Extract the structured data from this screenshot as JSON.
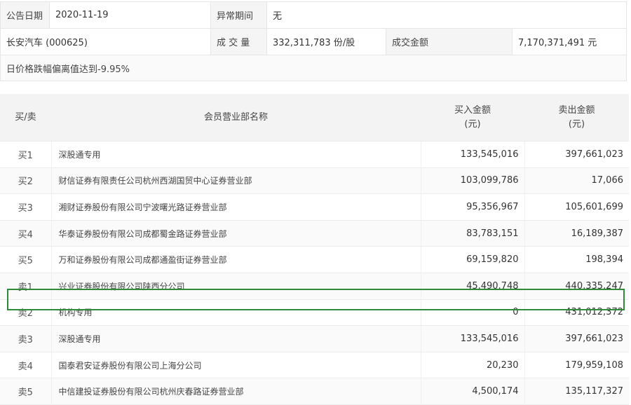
{
  "info": {
    "date_label": "公告日期",
    "date_value": "2020-11-19",
    "period_label": "异常期间",
    "period_value": "无",
    "stock_name": "长安汽车 (000625)",
    "volume_label": "成 交 量",
    "volume_value": "332,311,783 份/股",
    "amount_label": "成交金额",
    "amount_value": "7,170,371,491 元",
    "reason": "日价格跌幅偏离值达到-9.95%"
  },
  "table": {
    "headers": {
      "type": "买/卖",
      "name": "会员营业部名称",
      "buy": "买入金额\n(元)",
      "sell": "卖出金额\n(元)"
    },
    "rows": [
      {
        "type": "买1",
        "name": "深股通专用",
        "buy": "133,545,016",
        "sell": "397,661,023"
      },
      {
        "type": "买2",
        "name": "财信证券有限责任公司杭州西湖国贸中心证券营业部",
        "buy": "103,099,786",
        "sell": "17,066"
      },
      {
        "type": "买3",
        "name": "湘财证券股份有限公司宁波曙光路证券营业部",
        "buy": "95,356,967",
        "sell": "105,601,699"
      },
      {
        "type": "买4",
        "name": "华泰证券股份有限公司成都蜀金路证券营业部",
        "buy": "83,783,151",
        "sell": "16,189,387"
      },
      {
        "type": "买5",
        "name": "万和证券股份有限公司成都通盈街证券营业部",
        "buy": "69,159,820",
        "sell": "198,394"
      },
      {
        "type": "卖1",
        "name": "兴业证券股份有限公司陕西分公司",
        "buy": "45,490,748",
        "sell": "440,335,247"
      },
      {
        "type": "卖2",
        "name": "机构专用",
        "buy": "0",
        "sell": "431,012,372"
      },
      {
        "type": "卖3",
        "name": "深股通专用",
        "buy": "133,545,016",
        "sell": "397,661,023"
      },
      {
        "type": "卖4",
        "name": "国泰君安证券股份有限公司上海分公司",
        "buy": "20,230",
        "sell": "179,959,108"
      },
      {
        "type": "卖5",
        "name": "中信建投证券股份有限公司杭州庆春路证券营业部",
        "buy": "4,500,174",
        "sell": "135,117,327"
      }
    ]
  },
  "colors": {
    "highlight_border": "#2e8b3a",
    "header_bg": "#f3f3f3"
  }
}
